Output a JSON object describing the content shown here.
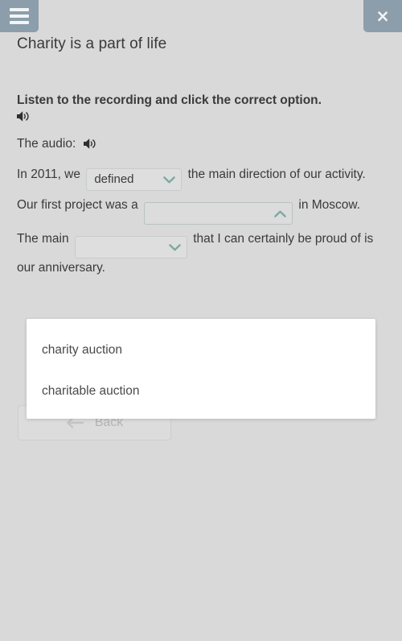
{
  "header": {
    "menu_icon": "hamburger-menu-icon",
    "close_icon": "close-icon",
    "close_label": "×",
    "accent_color": "#8c9eab"
  },
  "page": {
    "title": "Charity is a part of life",
    "background_color": "#d9d9d9",
    "text_color": "#3a3a3a"
  },
  "task": {
    "instruction": "Listen to the recording and click the correct option.",
    "instruction_speaker_icon": "speaker-icon",
    "audio_label": "The audio:",
    "audio_speaker_icon": "speaker-icon"
  },
  "sentences": {
    "one": {
      "before": "In 2011, we",
      "after": "the main direction of our activity."
    },
    "two": {
      "before": "Our first project was a",
      "after": "in Moscow."
    },
    "three": {
      "before": "The main",
      "after": "that I can certainly be proud of is our anniversary."
    }
  },
  "selects": {
    "verb": {
      "value": "defined",
      "chevron_icon": "chevron-down-icon",
      "state": "closed"
    },
    "event": {
      "value": "",
      "chevron_icon": "chevron-up-icon",
      "state": "open"
    },
    "noun": {
      "value": "",
      "chevron_icon": "chevron-down-icon",
      "state": "closed"
    },
    "chevron_color": "#7da9a1"
  },
  "dropdown": {
    "options": [
      {
        "label": "charity auction"
      },
      {
        "label": "charitable auction"
      }
    ]
  },
  "footer": {
    "back_label": "Back",
    "back_icon": "arrow-left-icon",
    "back_disabled": true
  }
}
